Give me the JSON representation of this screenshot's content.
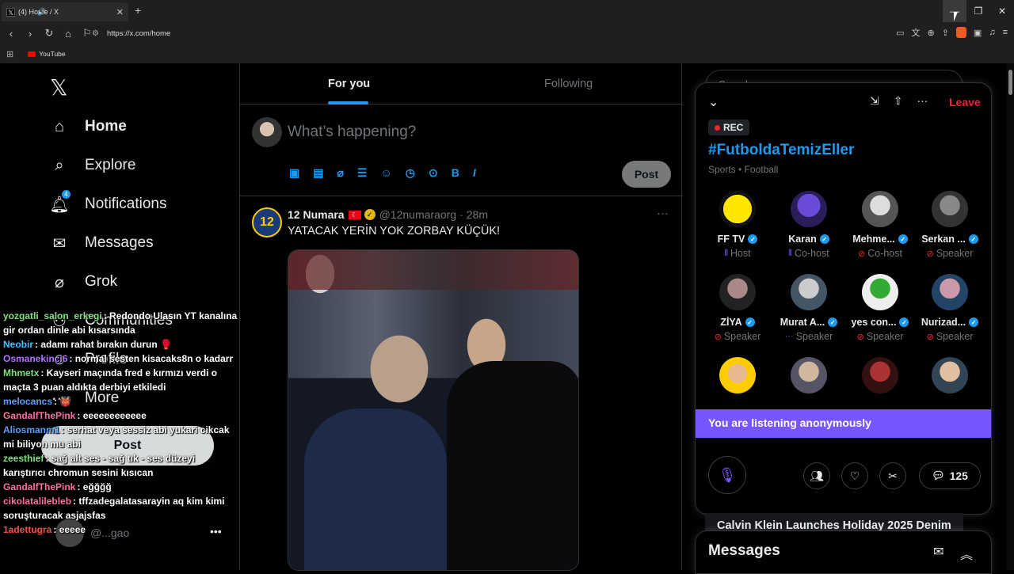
{
  "browser": {
    "tab_title": "(4) Home / X",
    "url": "https://x.com/home",
    "bookmark_youtube": "YouTube"
  },
  "nav": {
    "home": "Home",
    "explore": "Explore",
    "notifications": "Notifications",
    "notifications_badge": "4",
    "messages": "Messages",
    "grok": "Grok",
    "communities": "Communities",
    "profile": "Profile",
    "more": "More",
    "post": "Post",
    "account_handle": "@...gao"
  },
  "chat": [
    {
      "user": "yozgatli_salon_erkegi",
      "color": "#7ee07e",
      "text": ": Redondo Ulasın YT kanalına gir ordan dinle abi kısarsında"
    },
    {
      "user": "Neobir",
      "color": "#44c4ff",
      "text": ": adamı rahat bırakın durun 🥊"
    },
    {
      "user": "Osmanekinci6",
      "color": "#b072ff",
      "text": ": normal sesten kisacaks8n o kadarr"
    },
    {
      "user": "Mhmetx",
      "color": "#7ee07e",
      "text": ": Kayseri maçında fred e kırmızı verdi o maçta 3 puan aldıkta derbiyi etkiledi"
    },
    {
      "user": "melocancs",
      "color": "#5aa0ff",
      "text": ": 👹"
    },
    {
      "user": "GandalfThePink",
      "color": "#ff6fa5",
      "text": ": eeeeeeeeeeee"
    },
    {
      "user": "Aliosmanm1",
      "color": "#5aa0ff",
      "text": ": serhat veya sessiz abi yukari cikcak mi biliyon mu abi"
    },
    {
      "user": "zeesthief",
      "color": "#7ee07e",
      "text": ": sağ alt ses - sağ tık - ses düzeyi karıştırıcı chromun sesini kısıcan"
    },
    {
      "user": "GandalfThePink",
      "color": "#ff6fa5",
      "text": ": eğğğğ"
    },
    {
      "user": "cikolatalilebleb",
      "color": "#ff6fa5",
      "text": ": tffzadegalatasarayin aq kim kimi soruşturacak asjajsfas"
    },
    {
      "user": "1adettugra",
      "color": "#ff4a4a",
      "text": ": eeeee"
    }
  ],
  "feed": {
    "tab_for_you": "For you",
    "tab_following": "Following",
    "composer_placeholder": "What’s happening?",
    "post_button": "Post",
    "tweet": {
      "avatar_text": "12",
      "name": "12 Numara",
      "handle": "@12numaraorg",
      "time": "28m",
      "sep": "·",
      "text": "YATACAK YERİN YOK ZORBAY KÜÇÜK!"
    }
  },
  "space": {
    "leave": "Leave",
    "rec": "REC",
    "title": "#FutboldaTemizEller",
    "category": "Sports • Football",
    "speakers": [
      {
        "name": "FF TV",
        "role": "Host",
        "role_icon": "host"
      },
      {
        "name": "Karan",
        "role": "Co-host",
        "role_icon": "host"
      },
      {
        "name": "Mehme...",
        "role": "Co-host",
        "role_icon": "muted"
      },
      {
        "name": "Serkan ...",
        "role": "Speaker",
        "role_icon": "muted"
      },
      {
        "name": "ZİYA",
        "role": "Speaker",
        "role_icon": "muted"
      },
      {
        "name": "Murat A...",
        "role": "Speaker",
        "role_icon": "dots"
      },
      {
        "name": "yes con...",
        "role": "Speaker",
        "role_icon": "muted"
      },
      {
        "name": "Nurizad...",
        "role": "Speaker",
        "role_icon": "muted"
      }
    ],
    "listening_banner": "You are listening anonymously",
    "comment_count": "125"
  },
  "search_placeholder": "Search",
  "trend_peek": "Calvin Klein Launches Holiday 2025 Denim",
  "messages_drawer": "Messages",
  "colors": {
    "accent": "#1d9bf0",
    "space_purple": "#7856ff",
    "leave_red": "#f4212e"
  }
}
